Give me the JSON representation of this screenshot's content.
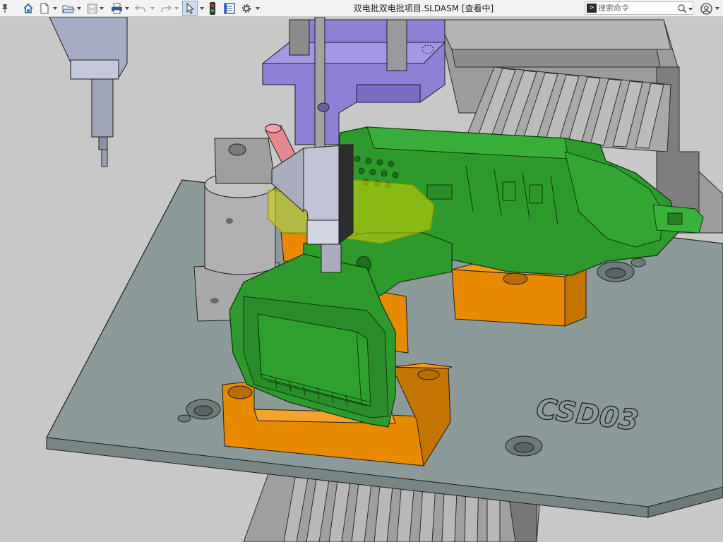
{
  "window": {
    "title": "双电批双电批项目.SLDASM [查看中]"
  },
  "toolbar": {
    "icons": [
      "pin-icon",
      "home-icon",
      "new-document-icon",
      "open-folder-icon",
      "save-icon",
      "print-icon",
      "undo-icon",
      "redo-icon",
      "select-pointer-icon",
      "rebuild-icon",
      "file-properties-icon",
      "options-gear-icon"
    ]
  },
  "search": {
    "placeholder": "搜索命令",
    "prompt_symbol": ">"
  },
  "viewport": {
    "model_engraving": "CSD03",
    "colors": {
      "background": "#c8c8c8",
      "plate": "#8d9a9a",
      "fixture_orange": "#e88a00",
      "tool_green": "#2e9a2e",
      "bracket_purple": "#8f80d6",
      "highlight_yellow": "#d4d400"
    }
  }
}
